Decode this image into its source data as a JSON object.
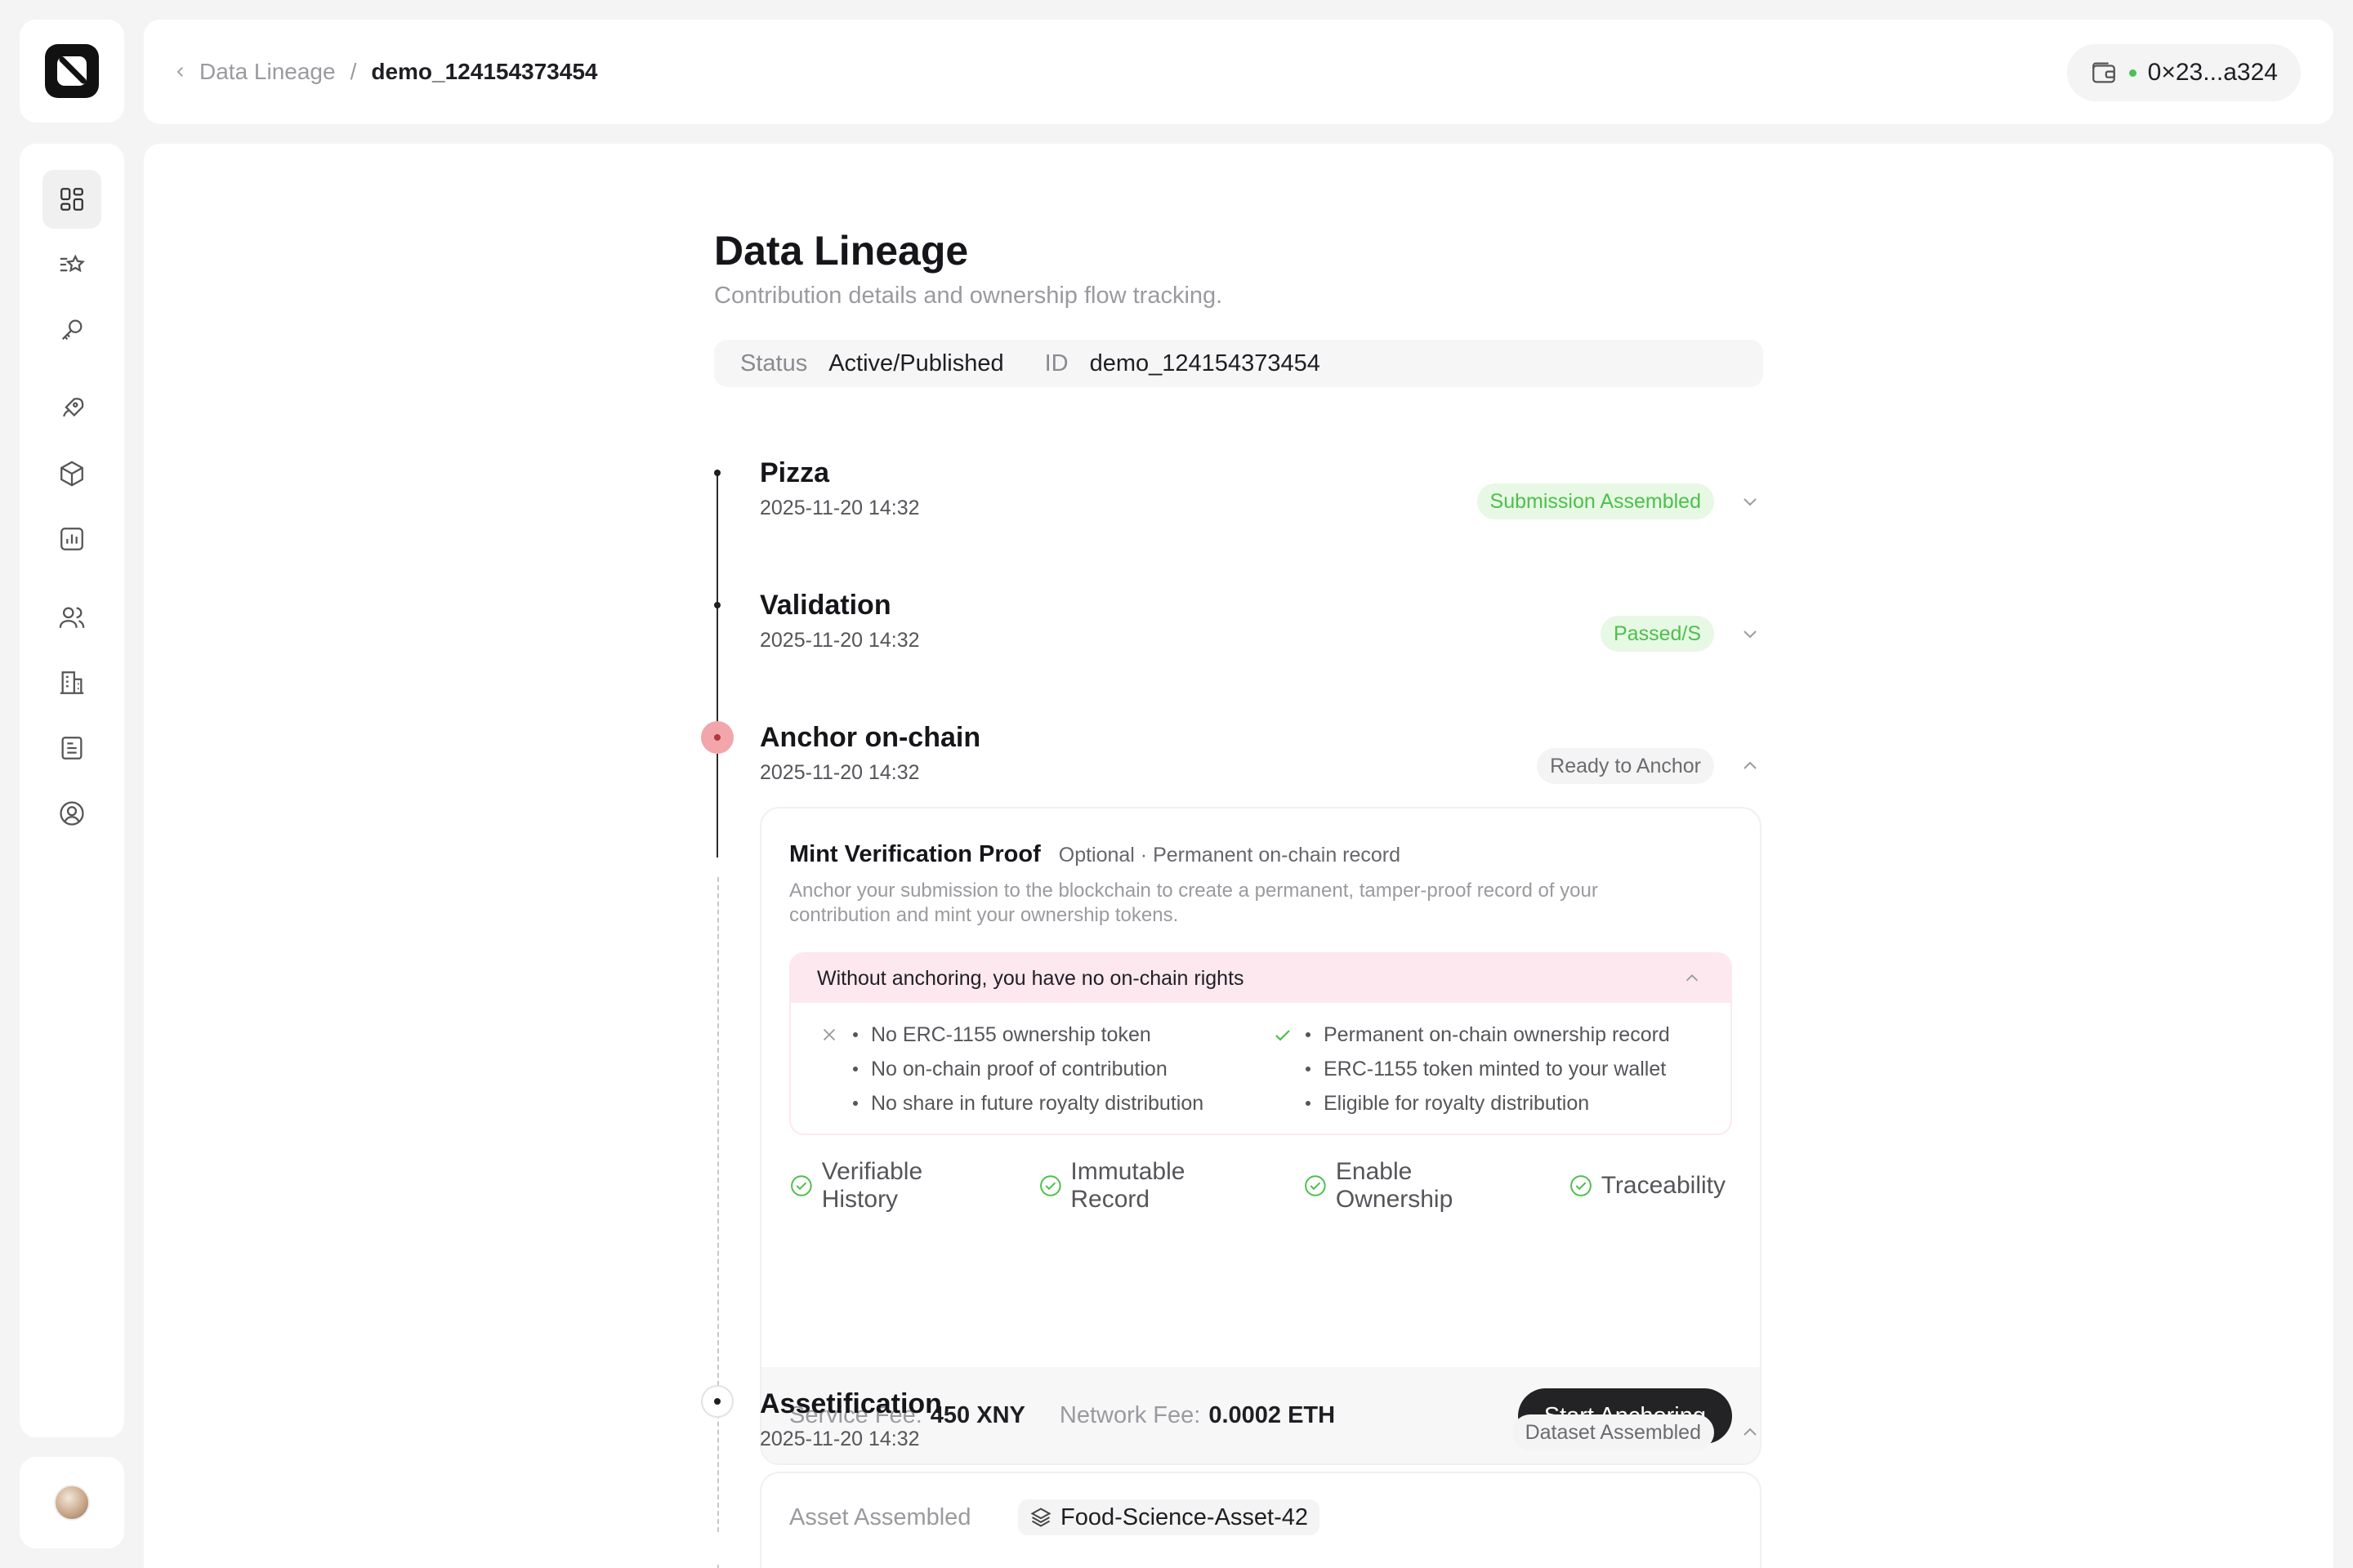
{
  "breadcrumb": {
    "parent": "Data Lineage",
    "separator": "/",
    "current": "demo_124154373454"
  },
  "wallet": {
    "address": "0×23...a324"
  },
  "sidebar": {
    "items": [
      {
        "icon": "dashboard-icon"
      },
      {
        "icon": "starred-list-icon"
      },
      {
        "icon": "key-icon"
      },
      {
        "icon": "rocket-icon"
      },
      {
        "icon": "box-icon"
      },
      {
        "icon": "bar-chart-icon"
      },
      {
        "icon": "users-icon"
      },
      {
        "icon": "building-icon"
      },
      {
        "icon": "document-icon"
      },
      {
        "icon": "user-circle-icon"
      }
    ]
  },
  "page": {
    "title": "Data Lineage",
    "subtitle": "Contribution details and ownership flow tracking."
  },
  "meta": {
    "status_label": "Status",
    "status_value": "Active/Published",
    "id_label": "ID",
    "id_value": "demo_124154373454"
  },
  "steps": [
    {
      "title": "Pizza",
      "date": "2025-11-20 14:32",
      "badge": "Submission Assembled"
    },
    {
      "title": "Validation",
      "date": "2025-11-20 14:32",
      "badge": "Passed/S"
    },
    {
      "title": "Anchor on-chain",
      "date": "2025-11-20 14:32",
      "badge": "Ready to Anchor"
    },
    {
      "title": "Assetification",
      "date": "2025-11-20 14:32",
      "badge": "Dataset Assembled"
    }
  ],
  "anchor_card": {
    "title": "Mint Verification Proof",
    "note": "Optional · Permanent on-chain record",
    "description": "Anchor your submission to the blockchain to create a permanent, tamper-proof record of your contribution and mint your ownership tokens.",
    "warning_title": "Without anchoring, you have no on-chain rights",
    "without": [
      "No ERC-1155 ownership token",
      "No on-chain proof of contribution",
      "No share in future royalty distribution"
    ],
    "with": [
      "Permanent on-chain ownership record",
      "ERC-1155 token minted to your wallet",
      "Eligible for royalty distribution"
    ],
    "features": [
      "Verifiable History",
      "Immutable Record",
      "Enable Ownership",
      "Traceability"
    ],
    "service_fee_label": "Service Fee:",
    "service_fee_value": "450 XNY",
    "network_fee_label": "Network Fee:",
    "network_fee_value": "0.0002 ETH",
    "button": "Start Anchoring"
  },
  "asset_card": {
    "asset_label": "Asset Assembled",
    "asset_value": "Food-Science-Asset-42"
  },
  "colors": {
    "accent_green": "#4cc04c",
    "warning_pink": "#fde8ef",
    "active_dot": "#f2a6ab",
    "primary_button": "#232325"
  }
}
